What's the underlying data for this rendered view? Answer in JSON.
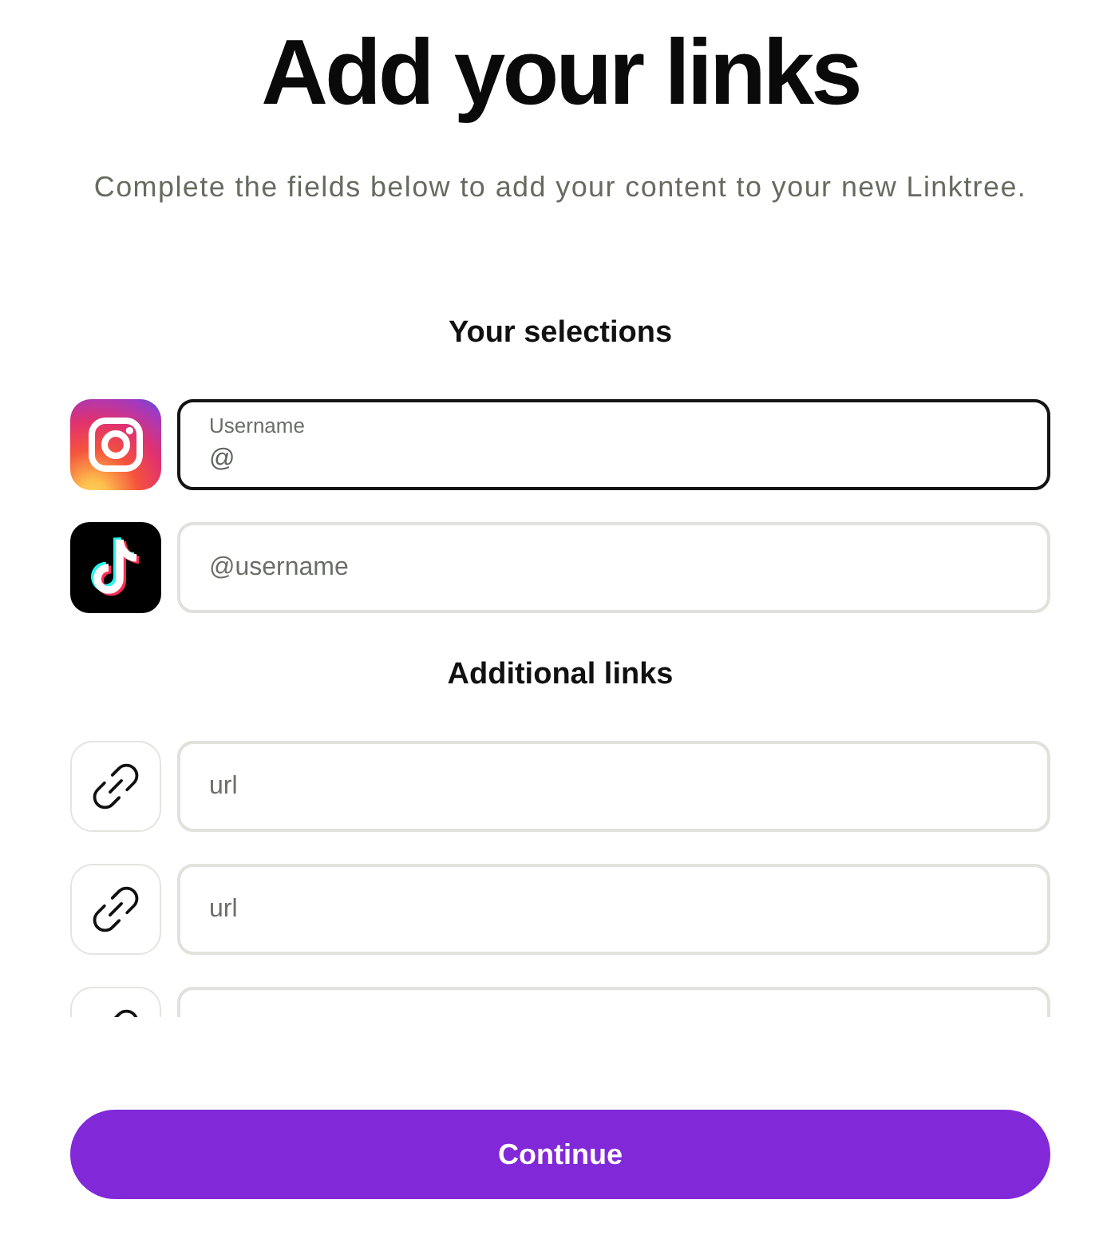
{
  "heading": {
    "title": "Add your links",
    "subtitle": "Complete the fields below to add your content to your new Linktree."
  },
  "selections": {
    "title": "Your selections",
    "items": [
      {
        "kind": "instagram",
        "label": "Username",
        "value": "@",
        "focused": true
      },
      {
        "kind": "tiktok",
        "placeholder": "@username",
        "focused": false
      }
    ]
  },
  "additional_links": {
    "title": "Additional links",
    "items": [
      {
        "placeholder": "url",
        "focused": false
      },
      {
        "placeholder": "url",
        "focused": false
      },
      {
        "focused": false
      }
    ]
  },
  "continue_button": {
    "label": "Continue"
  }
}
